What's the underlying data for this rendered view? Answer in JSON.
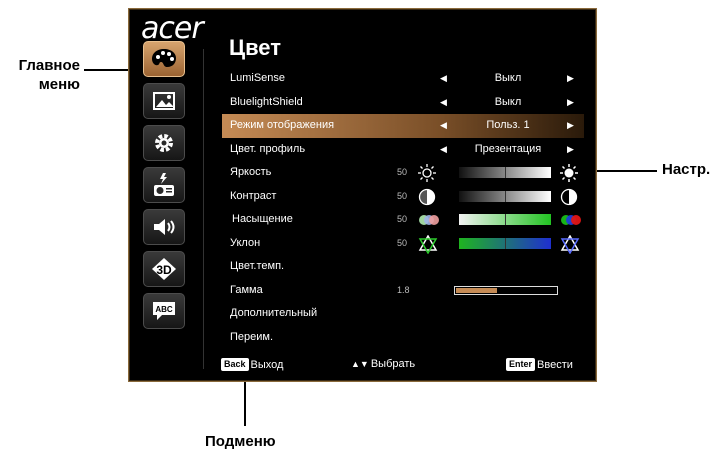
{
  "callouts": {
    "main_menu_line1": "Главное",
    "main_menu_line2": "меню",
    "settings": "Настр.",
    "submenu": "Подменю"
  },
  "brand": "acer",
  "page_title": "Цвет",
  "menu_icons": [
    "palette-icon",
    "image-icon",
    "gear-icon",
    "projector-icon",
    "speaker-icon",
    "3d-icon",
    "abc-icon"
  ],
  "rows": [
    {
      "label": "LumiSense",
      "value": "Выкл"
    },
    {
      "label": "BluelightShield",
      "value": "Выкл"
    },
    {
      "label": "Режим отображения",
      "value": "Польз. 1",
      "selected": true
    },
    {
      "label": "Цвет. профиль",
      "value": "Презентация"
    },
    {
      "label": "Яркость",
      "num": "50",
      "level": 0.5
    },
    {
      "label": "Контраст",
      "num": "50",
      "level": 0.5
    },
    {
      "label": "Насыщение",
      "num": "50",
      "level": 0.5
    },
    {
      "label": "Уклон",
      "num": "50",
      "level": 0.5
    },
    {
      "label": "Цвет.темп."
    },
    {
      "label": "Гамма",
      "num": "1.8",
      "level": 0.4
    },
    {
      "label": "Дополнительный"
    },
    {
      "label": "Переим."
    }
  ],
  "footer": {
    "back_key": "Back",
    "back_label": "Выход",
    "select_arrows": "▲▼",
    "select_label": "Выбрать",
    "enter_key": "Enter",
    "enter_label": "Ввести"
  },
  "colors": {
    "accent": "#c58b55",
    "osd_border": "#8a6a3c",
    "background": "#000000"
  }
}
